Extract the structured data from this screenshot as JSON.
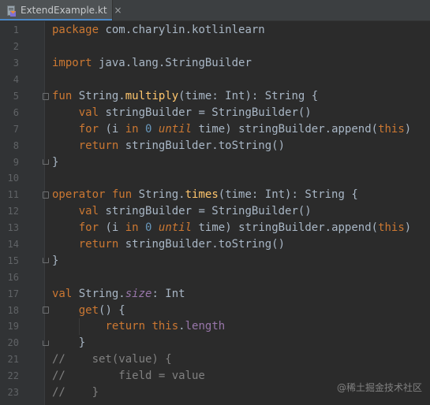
{
  "tab": {
    "filename": "ExtendExample.kt",
    "close_glyph": "×",
    "file_icon": "kotlin-file-icon"
  },
  "colors": {
    "background": "#2b2b2b",
    "keyword": "#cc7832",
    "function": "#ffc66d",
    "number": "#6897bb",
    "property": "#9876aa",
    "comment": "#808080",
    "text": "#a9b7c6"
  },
  "code_lines": [
    {
      "n": "1",
      "tokens": [
        [
          "kw",
          "package"
        ],
        [
          "plain",
          " com.charylin.kotlinlearn"
        ]
      ]
    },
    {
      "n": "2",
      "tokens": []
    },
    {
      "n": "3",
      "tokens": [
        [
          "kw",
          "import"
        ],
        [
          "plain",
          " java.lang.StringBuilder"
        ]
      ]
    },
    {
      "n": "4",
      "tokens": []
    },
    {
      "n": "5",
      "fold": "start",
      "tokens": [
        [
          "kw",
          "fun"
        ],
        [
          "plain",
          " String."
        ],
        [
          "fn",
          "multiply"
        ],
        [
          "plain",
          "(time: Int): String {"
        ]
      ]
    },
    {
      "n": "6",
      "tokens": [
        [
          "plain",
          "    "
        ],
        [
          "kw",
          "val"
        ],
        [
          "plain",
          " stringBuilder = StringBuilder()"
        ]
      ]
    },
    {
      "n": "7",
      "tokens": [
        [
          "plain",
          "    "
        ],
        [
          "kw",
          "for"
        ],
        [
          "plain",
          " (i "
        ],
        [
          "kw",
          "in"
        ],
        [
          "plain",
          " "
        ],
        [
          "num",
          "0"
        ],
        [
          "plain",
          " "
        ],
        [
          "kwi",
          "until"
        ],
        [
          "plain",
          " time) stringBuilder.append("
        ],
        [
          "kw",
          "this"
        ],
        [
          "plain",
          ")"
        ]
      ]
    },
    {
      "n": "8",
      "tokens": [
        [
          "plain",
          "    "
        ],
        [
          "kw",
          "return"
        ],
        [
          "plain",
          " stringBuilder.toString()"
        ]
      ]
    },
    {
      "n": "9",
      "fold": "end",
      "tokens": [
        [
          "plain",
          "}"
        ]
      ]
    },
    {
      "n": "10",
      "tokens": []
    },
    {
      "n": "11",
      "fold": "start",
      "tokens": [
        [
          "kw",
          "operator"
        ],
        [
          "plain",
          " "
        ],
        [
          "kw",
          "fun"
        ],
        [
          "plain",
          " String."
        ],
        [
          "fn",
          "times"
        ],
        [
          "plain",
          "(time: Int): String {"
        ]
      ]
    },
    {
      "n": "12",
      "tokens": [
        [
          "plain",
          "    "
        ],
        [
          "kw",
          "val"
        ],
        [
          "plain",
          " stringBuilder = StringBuilder()"
        ]
      ]
    },
    {
      "n": "13",
      "tokens": [
        [
          "plain",
          "    "
        ],
        [
          "kw",
          "for"
        ],
        [
          "plain",
          " (i "
        ],
        [
          "kw",
          "in"
        ],
        [
          "plain",
          " "
        ],
        [
          "num",
          "0"
        ],
        [
          "plain",
          " "
        ],
        [
          "kwi",
          "until"
        ],
        [
          "plain",
          " time) stringBuilder.append("
        ],
        [
          "kw",
          "this"
        ],
        [
          "plain",
          ")"
        ]
      ]
    },
    {
      "n": "14",
      "tokens": [
        [
          "plain",
          "    "
        ],
        [
          "kw",
          "return"
        ],
        [
          "plain",
          " stringBuilder.toString()"
        ]
      ]
    },
    {
      "n": "15",
      "fold": "end",
      "tokens": [
        [
          "plain",
          "}"
        ]
      ]
    },
    {
      "n": "16",
      "tokens": []
    },
    {
      "n": "17",
      "tokens": [
        [
          "kw",
          "val"
        ],
        [
          "plain",
          " String."
        ],
        [
          "it",
          "size"
        ],
        [
          "plain",
          ": Int"
        ]
      ]
    },
    {
      "n": "18",
      "fold": "start",
      "tokens": [
        [
          "plain",
          "    "
        ],
        [
          "kw",
          "get"
        ],
        [
          "plain",
          "() {"
        ]
      ]
    },
    {
      "n": "19",
      "tokens": [
        [
          "plain",
          "        "
        ],
        [
          "kw",
          "return"
        ],
        [
          "plain",
          " "
        ],
        [
          "kw",
          "this"
        ],
        [
          "plain",
          "."
        ],
        [
          "prop",
          "length"
        ]
      ]
    },
    {
      "n": "20",
      "fold": "end",
      "tokens": [
        [
          "plain",
          "    }"
        ]
      ]
    },
    {
      "n": "21",
      "tokens": [
        [
          "com",
          "//    set(value) {"
        ]
      ]
    },
    {
      "n": "22",
      "tokens": [
        [
          "com",
          "//        field = value"
        ]
      ]
    },
    {
      "n": "23",
      "tokens": [
        [
          "com",
          "//    }"
        ]
      ]
    }
  ],
  "watermark": "@稀土掘金技术社区"
}
